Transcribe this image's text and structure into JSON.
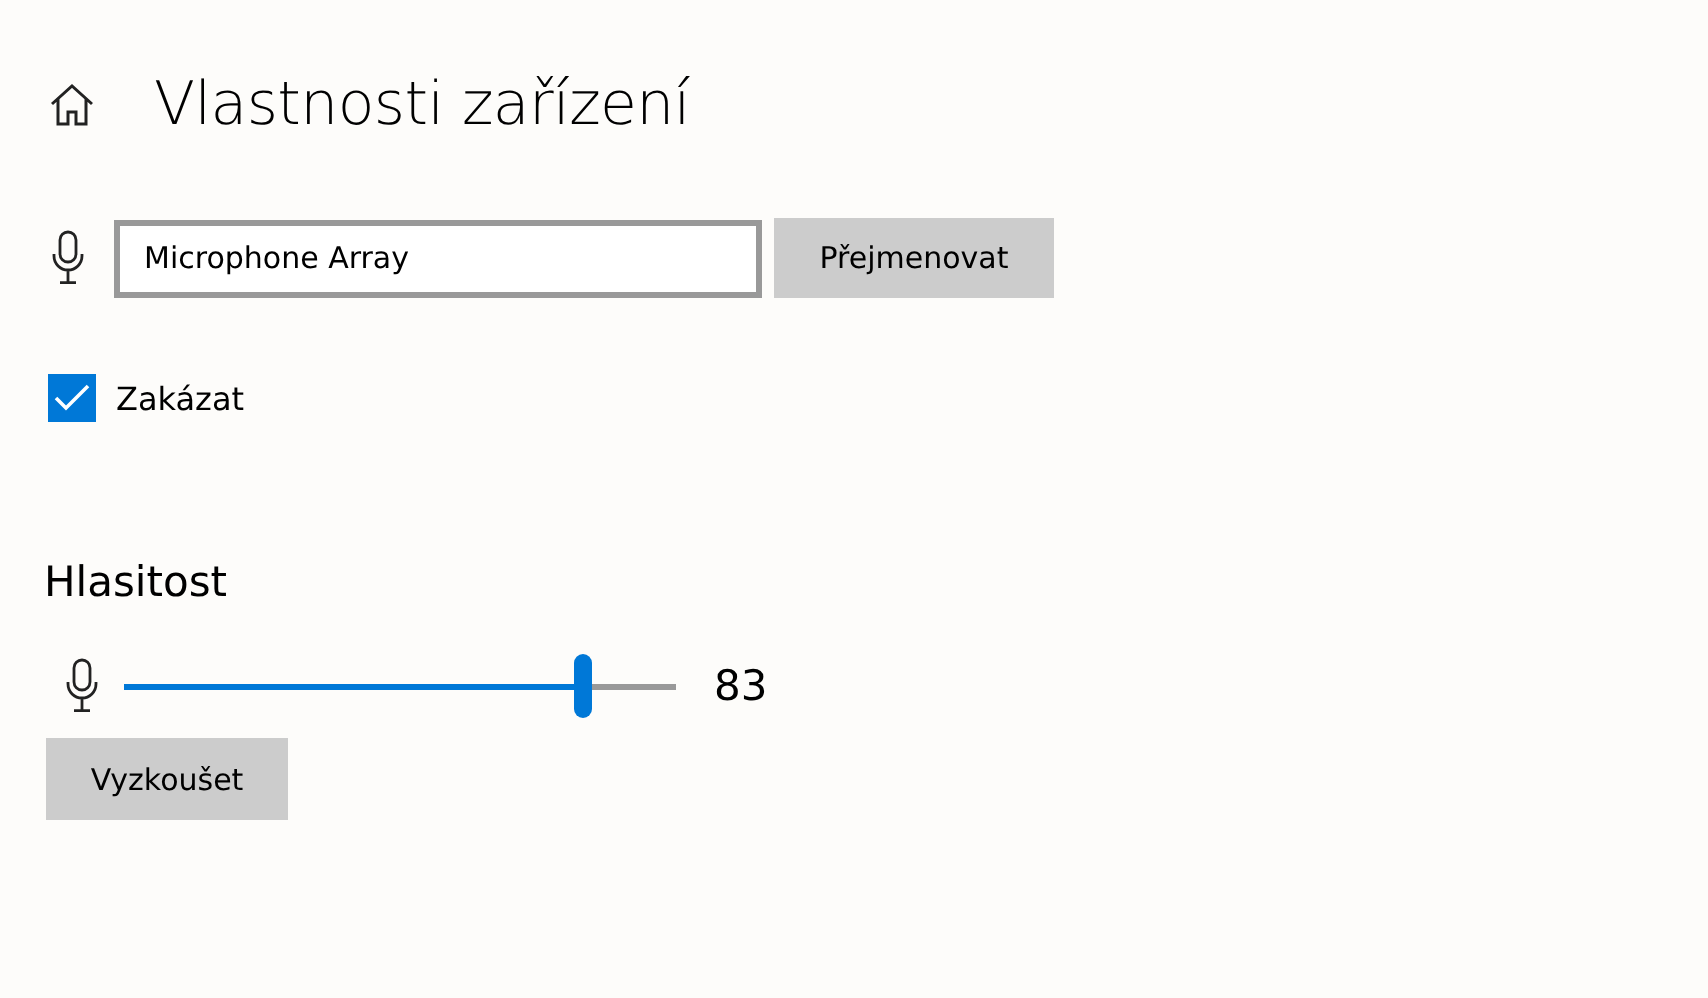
{
  "header": {
    "title": "Vlastnosti zařízení"
  },
  "device": {
    "name": "Microphone Array",
    "rename_button": "Přejmenovat"
  },
  "disable": {
    "label": "Zakázat",
    "checked": true
  },
  "volume": {
    "heading": "Hlasitost",
    "level": 0.83,
    "reading": "83",
    "test_button": "Vyzkoušet"
  }
}
